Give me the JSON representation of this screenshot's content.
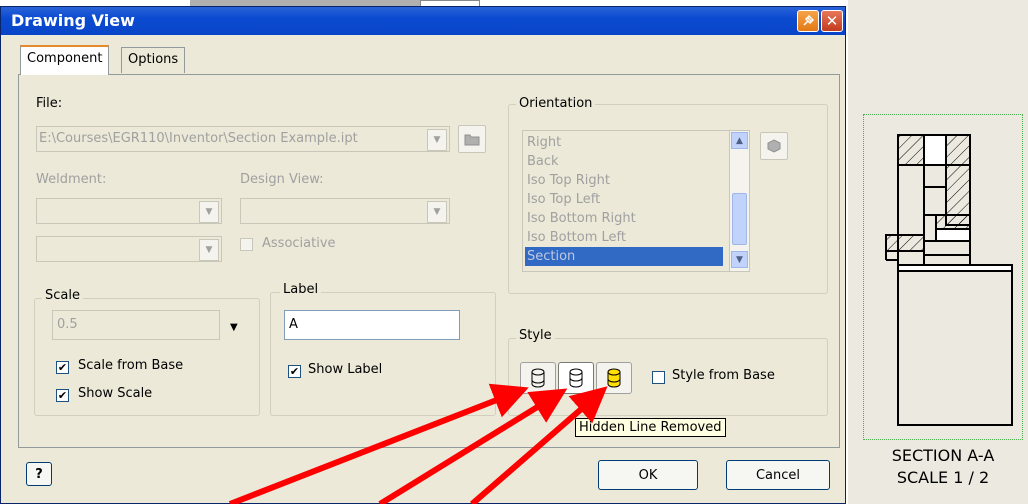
{
  "dialog": {
    "title": "Drawing View",
    "tabs": [
      {
        "label": "Component",
        "active": true
      },
      {
        "label": "Options",
        "active": false
      }
    ],
    "file": {
      "label": "File:",
      "value": "E:\\Courses\\EGR110\\Inventor\\Section Example.ipt"
    },
    "weldment": {
      "label": "Weldment:"
    },
    "design_view": {
      "label": "Design View:"
    },
    "associative": {
      "label": "Associative",
      "checked": false
    },
    "orientation": {
      "label": "Orientation",
      "items": [
        "Right",
        "Back",
        "Iso Top Right",
        "Iso Top Left",
        "Iso Bottom Right",
        "Iso Bottom Left",
        "Section"
      ],
      "selected": "Section"
    },
    "scale": {
      "label": "Scale",
      "value": "0.5",
      "scale_from_base": {
        "label": "Scale from Base",
        "checked": true
      },
      "show_scale": {
        "label": "Show Scale",
        "checked": true
      }
    },
    "view_label": {
      "label": "Label",
      "value": "A",
      "show_label": {
        "label": "Show Label",
        "checked": true
      }
    },
    "style": {
      "label": "Style",
      "style_from_base": {
        "label": "Style from Base",
        "checked": false
      },
      "tooltip": "Hidden Line Removed"
    },
    "buttons": {
      "help": "?",
      "ok": "OK",
      "cancel": "Cancel"
    },
    "check_mark": "✔"
  },
  "drawing": {
    "caption_line1": "SECTION  A-A",
    "caption_line2": "SCALE 1 / 2"
  },
  "colors": {
    "title_bar": "#0b4bd1",
    "selection": "#316ac5",
    "arrow": "#ff0000",
    "shaded_icon": "#ffe000",
    "frame_border": "#4caf50"
  }
}
